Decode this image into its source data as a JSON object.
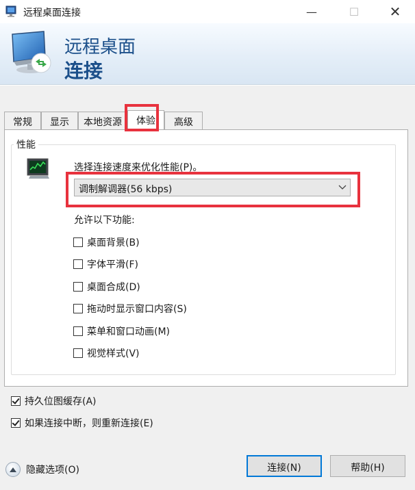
{
  "window": {
    "title": "远程桌面连接",
    "min_glyph": "—",
    "max_glyph": "☐",
    "close_glyph": "✕"
  },
  "banner": {
    "line1": "远程桌面",
    "line2": "连接"
  },
  "tabs": [
    {
      "label": "常规",
      "active": false
    },
    {
      "label": "显示",
      "active": false
    },
    {
      "label": "本地资源",
      "active": false
    },
    {
      "label": "体验",
      "active": true
    },
    {
      "label": "高级",
      "active": false
    }
  ],
  "performance": {
    "group_label": "性能",
    "speed_prompt": "选择连接速度来优化性能(P)。",
    "speed_selected": "调制解调器(56 kbps)",
    "allow_label": "允许以下功能:",
    "features": [
      {
        "label": "桌面背景(B)",
        "checked": false
      },
      {
        "label": "字体平滑(F)",
        "checked": false
      },
      {
        "label": "桌面合成(D)",
        "checked": false
      },
      {
        "label": "拖动时显示窗口内容(S)",
        "checked": false
      },
      {
        "label": "菜单和窗口动画(M)",
        "checked": false
      },
      {
        "label": "视觉样式(V)",
        "checked": false
      }
    ]
  },
  "options": [
    {
      "label": "持久位图缓存(A)",
      "checked": true
    },
    {
      "label": "如果连接中断，则重新连接(E)",
      "checked": true
    }
  ],
  "footer": {
    "hide_options": "隐藏选项(O)",
    "connect": "连接(N)",
    "help": "帮助(H)"
  },
  "colors": {
    "accent_blue": "#1b4f8a",
    "highlight_red": "#e8323e",
    "focus_blue": "#0078d7"
  }
}
